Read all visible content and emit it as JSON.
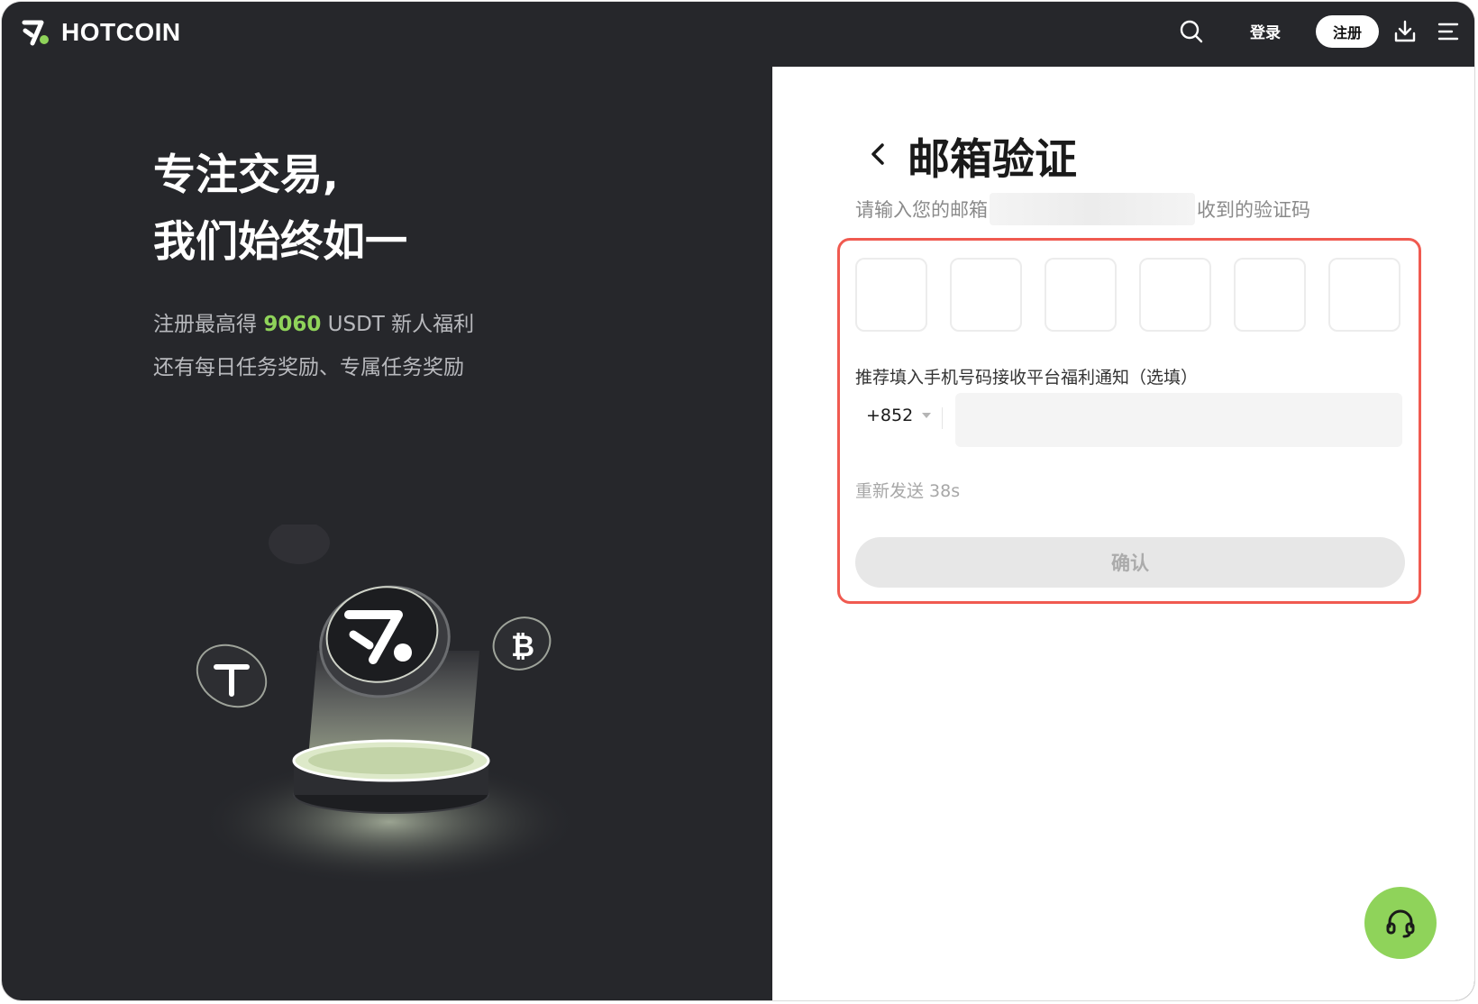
{
  "brand": {
    "name": "HOTCOIN",
    "accent": "#8fd35a"
  },
  "nav": {
    "search_icon": "search-icon",
    "login_label": "登录",
    "register_label": "注册",
    "download_icon": "download-icon",
    "menu_icon": "menu-icon"
  },
  "hero": {
    "title_line1": "专注交易,",
    "title_line2": "我们始终如一",
    "promo_prefix": "注册最高得 ",
    "promo_amount": "9060",
    "promo_suffix": " USDT 新人福利",
    "promo_line2": "还有每日任务奖励、专属任务奖励"
  },
  "verify": {
    "title": "邮箱验证",
    "subtitle_prefix": "请输入您的邮箱",
    "subtitle_suffix": "收到的验证码",
    "code_length": 6,
    "phone_label": "推荐填入手机号码接收平台福利通知（选填）",
    "country_code": "+852",
    "phone_value": "",
    "resend_label": "重新发送 38s",
    "confirm_label": "确认",
    "highlight_color": "#f05a50"
  },
  "support": {
    "icon": "headset-icon"
  }
}
